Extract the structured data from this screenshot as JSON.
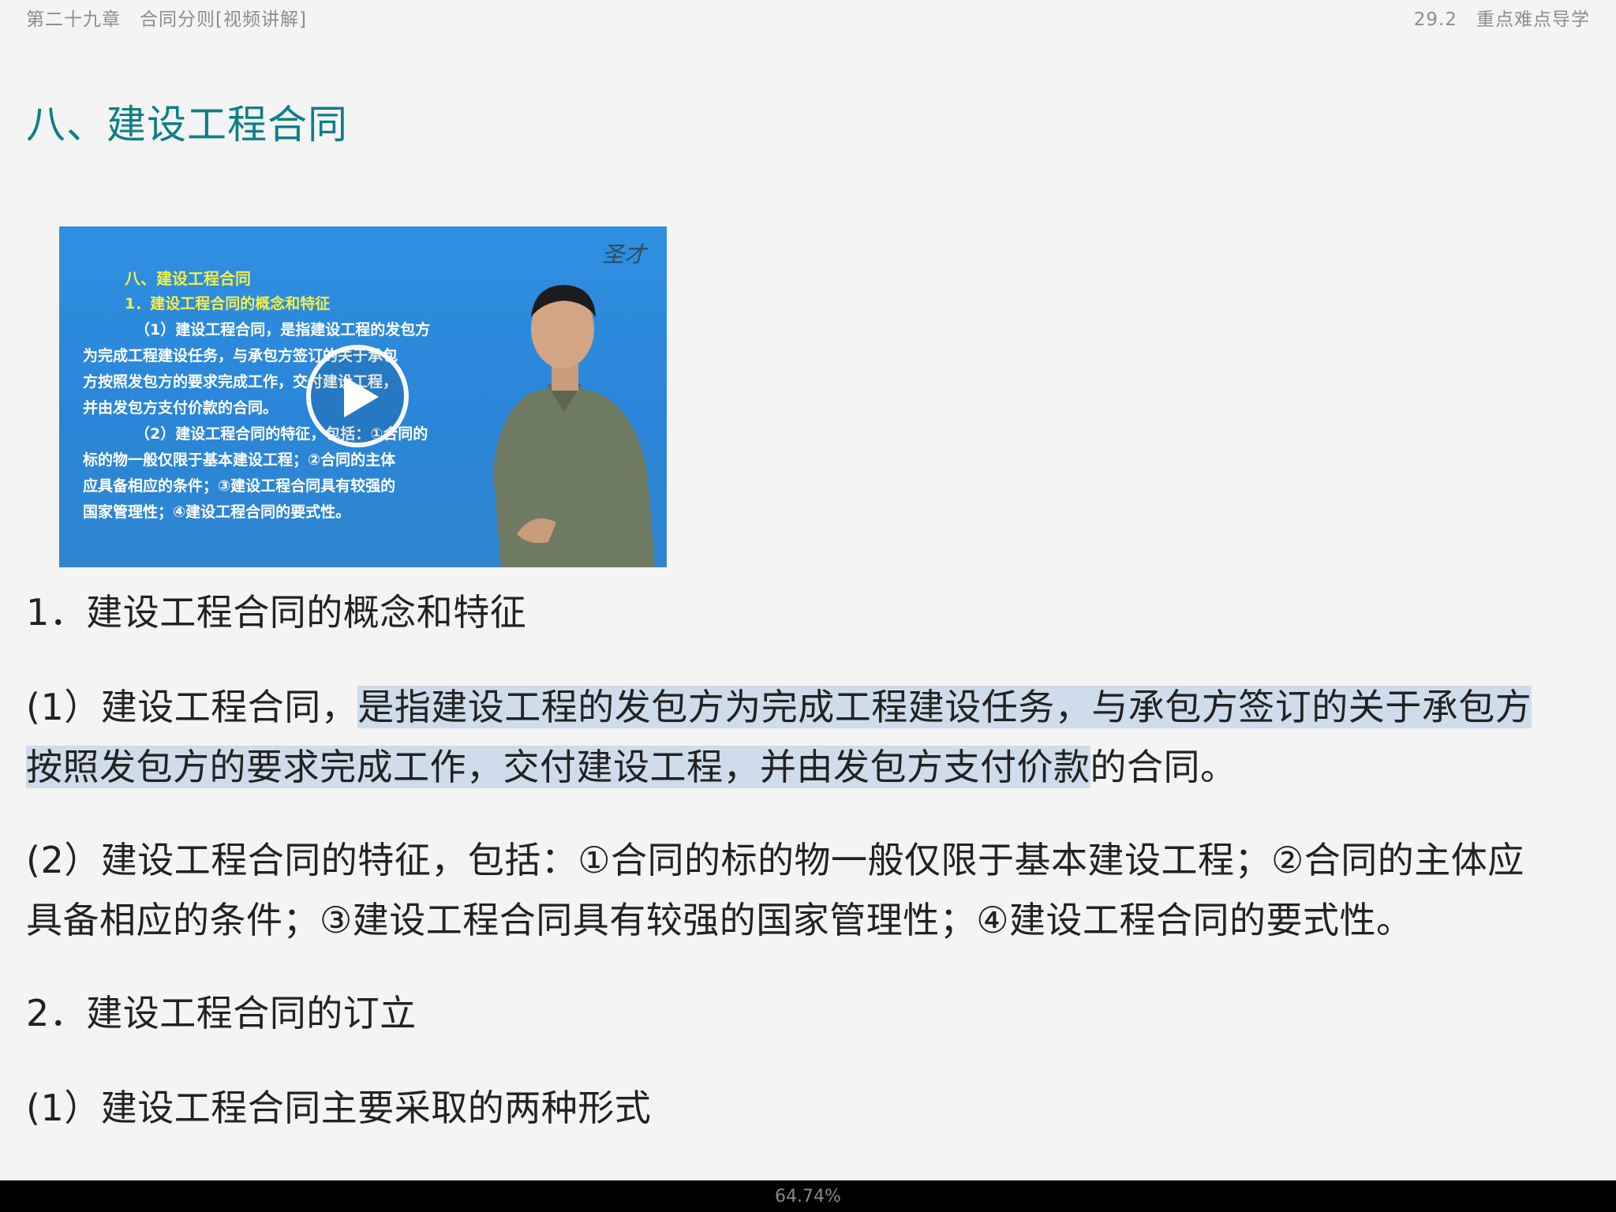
{
  "header": {
    "chapter": "第二十九章　合同分则[视频讲解]",
    "section": "29.2　重点难点导学"
  },
  "section_title": "八、建设工程合同",
  "video": {
    "logo": "圣才",
    "title": "八、建设工程合同",
    "subtitle": "1．建设工程合同的概念和特征",
    "lines": [
      "（1）建设工程合同，是指建设工程的发包方",
      "为完成工程建设任务，与承包方签订的关于承包",
      "方按照发包方的要求完成工作，交付建设工程，",
      "并由发包方支付价款的合同。",
      "（2）建设工程合同的特征，包括：①合同的",
      "标的物一般仅限于基本建设工程；②合同的主体",
      "应具备相应的条件；③建设工程合同具有较强的",
      "国家管理性；④建设工程合同的要式性。"
    ]
  },
  "content": {
    "heading1": "1．建设工程合同的概念和特征",
    "p1_prefix": "(1）建设工程合同，",
    "p1_highlight_a": "是指建设工程的发包方为完成工程建设任务，与承包方签订的关于承包方",
    "p1_highlight_b": "按照发包方的要求完成工作，交付建设工程，并由发包方支付价款",
    "p1_suffix": "的合同。",
    "p2_line1": "(2）建设工程合同的特征，包括：①合同的标的物一般仅限于基本建设工程；②合同的主体应",
    "p2_line2": "具备相应的条件；③建设工程合同具有较强的国家管理性；④建设工程合同的要式性。",
    "heading2": "2．建设工程合同的订立",
    "p3": "(1）建设工程合同主要采取的两种形式"
  },
  "reading_progress": "64.74%"
}
